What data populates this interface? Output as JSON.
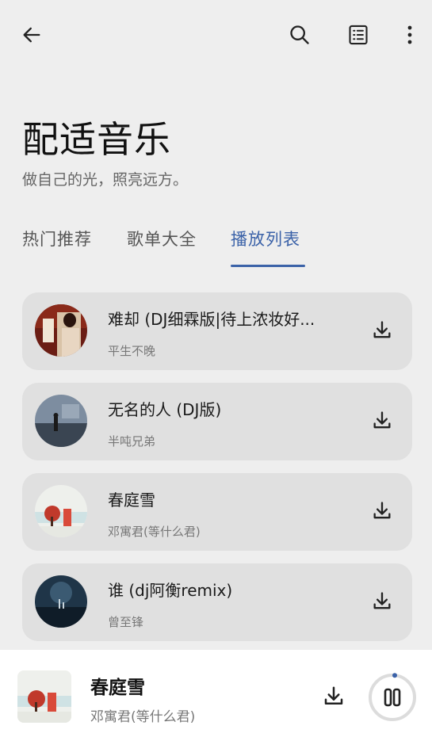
{
  "header": {
    "back_icon": "arrow-left-icon",
    "search_icon": "search-icon",
    "list_icon": "list-view-icon",
    "more_icon": "more-vertical-icon"
  },
  "hero": {
    "title": "配适音乐",
    "subtitle": "做自己的光，照亮远方。"
  },
  "tabs": [
    {
      "label": "热门推荐"
    },
    {
      "label": "歌单大全"
    },
    {
      "label": "播放列表",
      "active": true
    }
  ],
  "playlist": [
    {
      "title": "难却 (DJ细霖版|待上浓妆好...",
      "artist": "平生不晚"
    },
    {
      "title": "无名的人 (DJ版)",
      "artist": "半吨兄弟"
    },
    {
      "title": "春庭雪",
      "artist": "邓寓君(等什么君)"
    },
    {
      "title": "谁 (dj阿衡remix)",
      "artist": "曾至锋"
    }
  ],
  "now_playing": {
    "title": "春庭雪",
    "artist": "邓寓君(等什么君)",
    "state": "playing"
  },
  "colors": {
    "accent": "#3b62a8",
    "background": "#eeeeee",
    "card": "#e0e0e0"
  }
}
